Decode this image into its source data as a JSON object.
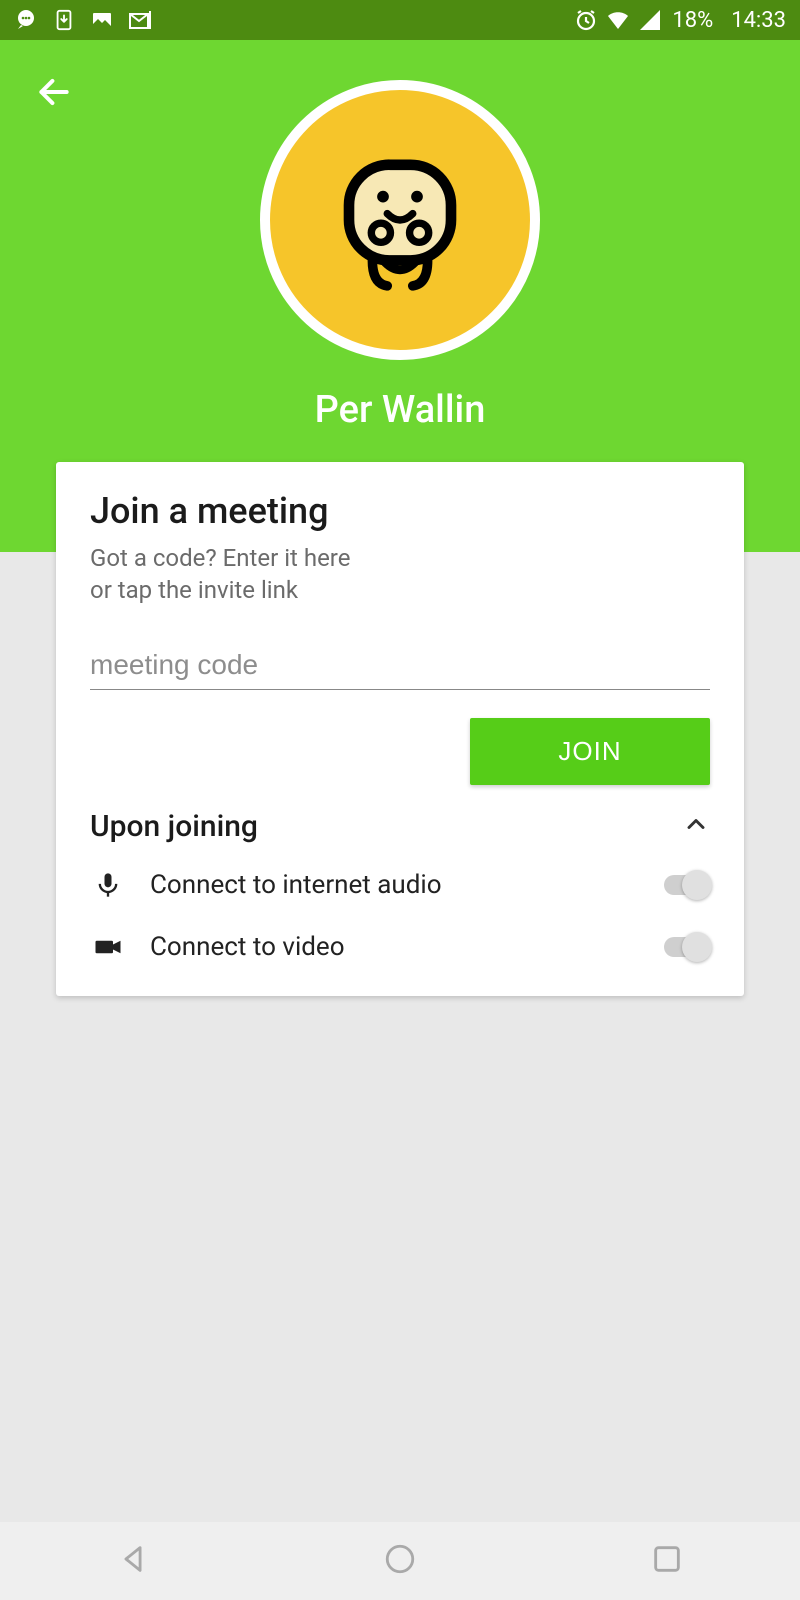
{
  "statusbar": {
    "battery": "18%",
    "time": "14:33"
  },
  "profile": {
    "name": "Per Wallin"
  },
  "card": {
    "title": "Join a meeting",
    "subtitle": "Got a code? Enter it here\nor tap the invite link",
    "placeholder": "meeting code",
    "join_label": "JOIN",
    "section_title": "Upon joining",
    "options": {
      "audio": "Connect to internet audio",
      "video": "Connect to video"
    }
  },
  "colors": {
    "primary": "#6ed731",
    "avatar_bg": "#f6c52a"
  }
}
